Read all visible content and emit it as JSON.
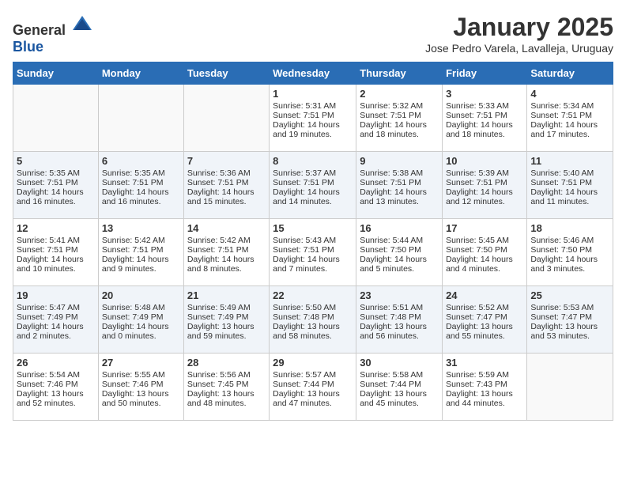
{
  "header": {
    "logo_general": "General",
    "logo_blue": "Blue",
    "title": "January 2025",
    "subtitle": "Jose Pedro Varela, Lavalleja, Uruguay"
  },
  "weekdays": [
    "Sunday",
    "Monday",
    "Tuesday",
    "Wednesday",
    "Thursday",
    "Friday",
    "Saturday"
  ],
  "weeks": [
    [
      {
        "day": "",
        "lines": []
      },
      {
        "day": "",
        "lines": []
      },
      {
        "day": "",
        "lines": []
      },
      {
        "day": "1",
        "lines": [
          "Sunrise: 5:31 AM",
          "Sunset: 7:51 PM",
          "Daylight: 14 hours",
          "and 19 minutes."
        ]
      },
      {
        "day": "2",
        "lines": [
          "Sunrise: 5:32 AM",
          "Sunset: 7:51 PM",
          "Daylight: 14 hours",
          "and 18 minutes."
        ]
      },
      {
        "day": "3",
        "lines": [
          "Sunrise: 5:33 AM",
          "Sunset: 7:51 PM",
          "Daylight: 14 hours",
          "and 18 minutes."
        ]
      },
      {
        "day": "4",
        "lines": [
          "Sunrise: 5:34 AM",
          "Sunset: 7:51 PM",
          "Daylight: 14 hours",
          "and 17 minutes."
        ]
      }
    ],
    [
      {
        "day": "5",
        "lines": [
          "Sunrise: 5:35 AM",
          "Sunset: 7:51 PM",
          "Daylight: 14 hours",
          "and 16 minutes."
        ]
      },
      {
        "day": "6",
        "lines": [
          "Sunrise: 5:35 AM",
          "Sunset: 7:51 PM",
          "Daylight: 14 hours",
          "and 16 minutes."
        ]
      },
      {
        "day": "7",
        "lines": [
          "Sunrise: 5:36 AM",
          "Sunset: 7:51 PM",
          "Daylight: 14 hours",
          "and 15 minutes."
        ]
      },
      {
        "day": "8",
        "lines": [
          "Sunrise: 5:37 AM",
          "Sunset: 7:51 PM",
          "Daylight: 14 hours",
          "and 14 minutes."
        ]
      },
      {
        "day": "9",
        "lines": [
          "Sunrise: 5:38 AM",
          "Sunset: 7:51 PM",
          "Daylight: 14 hours",
          "and 13 minutes."
        ]
      },
      {
        "day": "10",
        "lines": [
          "Sunrise: 5:39 AM",
          "Sunset: 7:51 PM",
          "Daylight: 14 hours",
          "and 12 minutes."
        ]
      },
      {
        "day": "11",
        "lines": [
          "Sunrise: 5:40 AM",
          "Sunset: 7:51 PM",
          "Daylight: 14 hours",
          "and 11 minutes."
        ]
      }
    ],
    [
      {
        "day": "12",
        "lines": [
          "Sunrise: 5:41 AM",
          "Sunset: 7:51 PM",
          "Daylight: 14 hours",
          "and 10 minutes."
        ]
      },
      {
        "day": "13",
        "lines": [
          "Sunrise: 5:42 AM",
          "Sunset: 7:51 PM",
          "Daylight: 14 hours",
          "and 9 minutes."
        ]
      },
      {
        "day": "14",
        "lines": [
          "Sunrise: 5:42 AM",
          "Sunset: 7:51 PM",
          "Daylight: 14 hours",
          "and 8 minutes."
        ]
      },
      {
        "day": "15",
        "lines": [
          "Sunrise: 5:43 AM",
          "Sunset: 7:51 PM",
          "Daylight: 14 hours",
          "and 7 minutes."
        ]
      },
      {
        "day": "16",
        "lines": [
          "Sunrise: 5:44 AM",
          "Sunset: 7:50 PM",
          "Daylight: 14 hours",
          "and 5 minutes."
        ]
      },
      {
        "day": "17",
        "lines": [
          "Sunrise: 5:45 AM",
          "Sunset: 7:50 PM",
          "Daylight: 14 hours",
          "and 4 minutes."
        ]
      },
      {
        "day": "18",
        "lines": [
          "Sunrise: 5:46 AM",
          "Sunset: 7:50 PM",
          "Daylight: 14 hours",
          "and 3 minutes."
        ]
      }
    ],
    [
      {
        "day": "19",
        "lines": [
          "Sunrise: 5:47 AM",
          "Sunset: 7:49 PM",
          "Daylight: 14 hours",
          "and 2 minutes."
        ]
      },
      {
        "day": "20",
        "lines": [
          "Sunrise: 5:48 AM",
          "Sunset: 7:49 PM",
          "Daylight: 14 hours",
          "and 0 minutes."
        ]
      },
      {
        "day": "21",
        "lines": [
          "Sunrise: 5:49 AM",
          "Sunset: 7:49 PM",
          "Daylight: 13 hours",
          "and 59 minutes."
        ]
      },
      {
        "day": "22",
        "lines": [
          "Sunrise: 5:50 AM",
          "Sunset: 7:48 PM",
          "Daylight: 13 hours",
          "and 58 minutes."
        ]
      },
      {
        "day": "23",
        "lines": [
          "Sunrise: 5:51 AM",
          "Sunset: 7:48 PM",
          "Daylight: 13 hours",
          "and 56 minutes."
        ]
      },
      {
        "day": "24",
        "lines": [
          "Sunrise: 5:52 AM",
          "Sunset: 7:47 PM",
          "Daylight: 13 hours",
          "and 55 minutes."
        ]
      },
      {
        "day": "25",
        "lines": [
          "Sunrise: 5:53 AM",
          "Sunset: 7:47 PM",
          "Daylight: 13 hours",
          "and 53 minutes."
        ]
      }
    ],
    [
      {
        "day": "26",
        "lines": [
          "Sunrise: 5:54 AM",
          "Sunset: 7:46 PM",
          "Daylight: 13 hours",
          "and 52 minutes."
        ]
      },
      {
        "day": "27",
        "lines": [
          "Sunrise: 5:55 AM",
          "Sunset: 7:46 PM",
          "Daylight: 13 hours",
          "and 50 minutes."
        ]
      },
      {
        "day": "28",
        "lines": [
          "Sunrise: 5:56 AM",
          "Sunset: 7:45 PM",
          "Daylight: 13 hours",
          "and 48 minutes."
        ]
      },
      {
        "day": "29",
        "lines": [
          "Sunrise: 5:57 AM",
          "Sunset: 7:44 PM",
          "Daylight: 13 hours",
          "and 47 minutes."
        ]
      },
      {
        "day": "30",
        "lines": [
          "Sunrise: 5:58 AM",
          "Sunset: 7:44 PM",
          "Daylight: 13 hours",
          "and 45 minutes."
        ]
      },
      {
        "day": "31",
        "lines": [
          "Sunrise: 5:59 AM",
          "Sunset: 7:43 PM",
          "Daylight: 13 hours",
          "and 44 minutes."
        ]
      },
      {
        "day": "",
        "lines": []
      }
    ]
  ]
}
